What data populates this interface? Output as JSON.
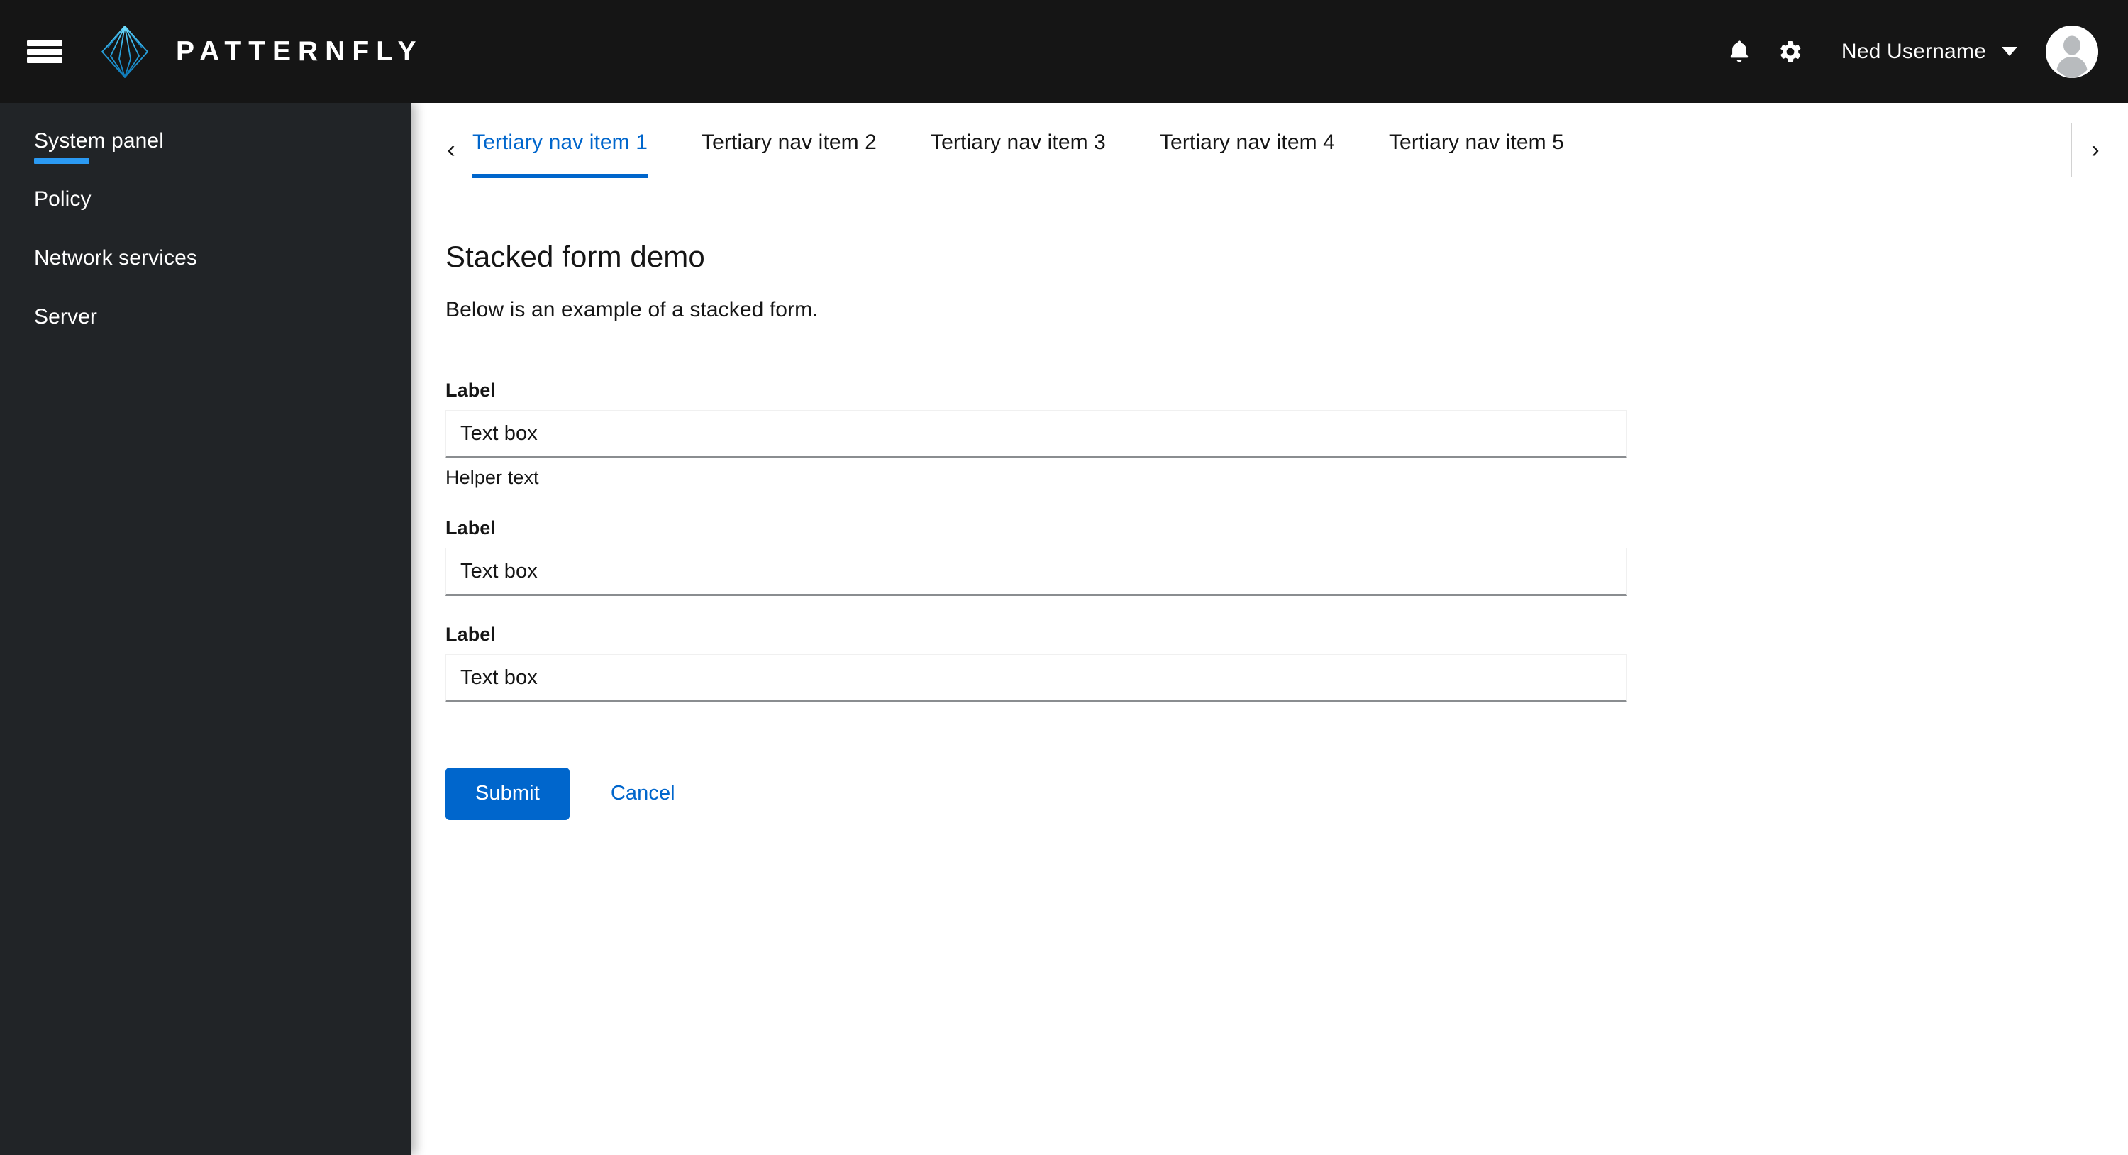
{
  "masthead": {
    "toggle_name": "global-navigation-toggle",
    "brand_name": "PATTERNFLY",
    "notifications_label": "Notifications",
    "settings_label": "Settings",
    "user_name": "Ned Username",
    "avatar_label": "User avatar",
    "colors": {
      "background": "#151515",
      "brand_accent": "#2BA5E0"
    }
  },
  "sidebar": {
    "items": [
      {
        "label": "System panel",
        "active": true
      },
      {
        "label": "Policy",
        "active": false
      },
      {
        "label": "Network services",
        "active": false
      },
      {
        "label": "Server",
        "active": false
      }
    ],
    "colors": {
      "background": "#212427",
      "active_indicator": "#2B9AF3",
      "separator": "#3C3F42"
    }
  },
  "tertiary_nav": {
    "scroll_left_label": "‹",
    "scroll_right_label": "›",
    "tabs": [
      {
        "label": "Tertiary nav item 1",
        "active": true
      },
      {
        "label": "Tertiary nav item 2",
        "active": false
      },
      {
        "label": "Tertiary nav item 3",
        "active": false
      },
      {
        "label": "Tertiary nav item 4",
        "active": false
      },
      {
        "label": "Tertiary nav item 5",
        "active": false
      }
    ],
    "active_color": "#0066CC"
  },
  "main": {
    "title": "Stacked form demo",
    "description": "Below is an example of a stacked form.",
    "form": {
      "fields": [
        {
          "label": "Label",
          "value": "Text box",
          "placeholder": "Text box",
          "helper_text": "Helper text"
        },
        {
          "label": "Label",
          "value": "Text box",
          "placeholder": "Text box",
          "helper_text": ""
        },
        {
          "label": "Label",
          "value": "Text box",
          "placeholder": "Text box",
          "helper_text": ""
        }
      ],
      "submit_label": "Submit",
      "cancel_label": "Cancel",
      "primary_color": "#0066CC"
    }
  }
}
